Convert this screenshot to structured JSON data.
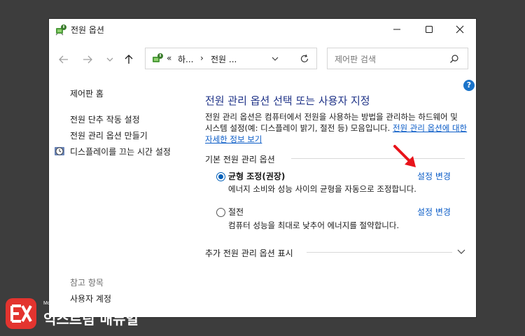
{
  "window": {
    "title": "전원 옵션"
  },
  "navbar": {
    "breadcrumb_prefix": "«",
    "crumb1": "하...",
    "separator": "›",
    "crumb2": "전원 ...",
    "search_placeholder": "제어판 검색"
  },
  "sidebar": {
    "home": "제어판 홈",
    "items": [
      "전원 단추 작동 설정",
      "전원 관리 옵션 만들기",
      "디스플레이를 끄는 시간 설정"
    ],
    "see_also_heading": "참고 항목",
    "see_also_items": [
      "사용자 계정"
    ]
  },
  "main": {
    "title": "전원 관리 옵션 선택 또는 사용자 지정",
    "description": "전원 관리 옵션은 컴퓨터에서 전원을 사용하는 방법을 관리하는 하드웨어 및 시스템 설정(예: 디스플레이 밝기, 절전 등) 모음입니다.",
    "description_link": "전원 관리 옵션에 대한 자세한 정보 보기",
    "group_label": "기본 전원 관리 옵션",
    "plans": [
      {
        "name": "균형 조정(권장)",
        "desc": "에너지 소비와 성능 사이의 균형을 자동으로 조정합니다.",
        "link": "설정 변경",
        "selected": true
      },
      {
        "name": "절전",
        "desc": "컴퓨터 성능을 최대로 낮추어 에너지를 절약합니다.",
        "link": "설정 변경",
        "selected": false
      }
    ],
    "extra_label": "추가 전원 관리 옵션 표시"
  },
  "help": {
    "label": "?"
  },
  "watermark": {
    "tagline": "More Better IT Life",
    "brand": "익스트림 매뉴얼"
  },
  "colors": {
    "accent": "#005fb8",
    "link": "#0b5cc7",
    "title_blue": "#1e3287",
    "arrow_red": "#e8131a",
    "brand_red": "#e3342f"
  }
}
